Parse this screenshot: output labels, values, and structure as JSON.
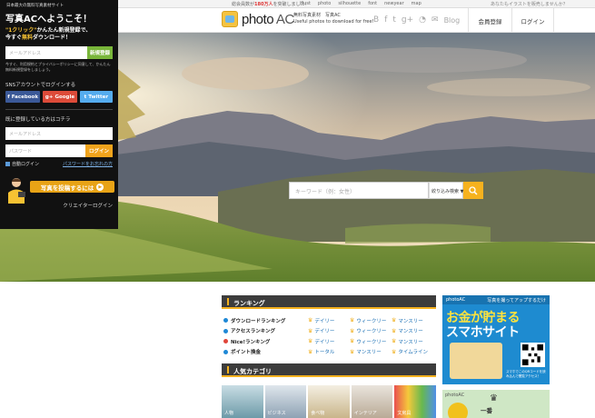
{
  "topbar": {
    "count_prefix": "総会員数が",
    "count_value": "180万人",
    "count_suffix": "を突破しました！",
    "sites": [
      "illust",
      "photo",
      "silhouette",
      "font",
      "newyear",
      "map"
    ],
    "promo": "あなたもイラストを販売しませんか？"
  },
  "header": {
    "logo_text": "photo",
    "logo_text_ac": "AC",
    "tagline_1": "無料写真素材　写真AC",
    "tagline_2": "Useful photos to download for free!",
    "social_icons": [
      "blogger-icon",
      "facebook-icon",
      "twitter-icon",
      "google-plus-icon",
      "rss-icon",
      "mail-icon"
    ],
    "blog_label": "Blog",
    "register_label": "会員登録",
    "login_label": "ログイン"
  },
  "search": {
    "placeholder": "キーワード（例：女性）",
    "filter_label": "絞り込み検索 ▼"
  },
  "panel": {
    "site_note": "日本最大の無料写真素材サイト",
    "welcome": "写真ACへようこそ！",
    "pitch_1a": "\"1クリック\"",
    "pitch_1b": "かんたん新規登録で、",
    "pitch_2a": "今すぐ",
    "pitch_2b": "無料",
    "pitch_2c": "ダウンロード！",
    "signup_placeholder": "メールアドレス",
    "signup_button": "新規登録",
    "terms": "今すぐ、利用規約とプライバシーポリシーに同意して、かんたん無料新規登録をしましょう。",
    "sns_title": "SNSアカウントでログインする",
    "facebook": "Facebook",
    "google": "Google",
    "twitter": "Twitter",
    "member_title": "既に登録している方はコチラ",
    "email_placeholder": "メールアドレス",
    "password_placeholder": "パスワード",
    "login_button": "ログイン",
    "auto_login": "自動ログイン",
    "forgot": "パスワードをお忘れの方",
    "post_button": "写真を投稿するには",
    "creator_login": "クリエイターログイン"
  },
  "ranking": {
    "title": "ランキング",
    "rows": [
      {
        "name": "ダウンロードランキング",
        "icon_color": "#1e88d6",
        "cols": [
          "デイリー",
          "ウィークリー",
          "マンスリー"
        ]
      },
      {
        "name": "アクセスランキング",
        "icon_color": "#1e88d6",
        "cols": [
          "デイリー",
          "ウィークリー",
          "マンスリー"
        ]
      },
      {
        "name": "Nice!ランキング",
        "icon_color": "#e0453a",
        "cols": [
          "デイリー",
          "ウィークリー",
          "マンスリー"
        ]
      },
      {
        "name": "ポイント換金",
        "icon_color": "#1e88d6",
        "cols": [
          "トータル",
          "マンスリー",
          "タイムライン"
        ]
      }
    ]
  },
  "categories": {
    "title": "人気カテゴリ",
    "items": [
      "人物",
      "ビジネス",
      "食べ物",
      "インテリア",
      "文房具"
    ]
  },
  "ad1": {
    "logo": "photoAC",
    "top": "写真を撮ってアップするだけ",
    "big1": "お金が貯まる",
    "big2": "スマホサイト",
    "qr_note": "スマホでこのQRコードを読み込んで閲覧アクセス！"
  },
  "ad2": {
    "logo": "photoAC",
    "text": "一番"
  }
}
